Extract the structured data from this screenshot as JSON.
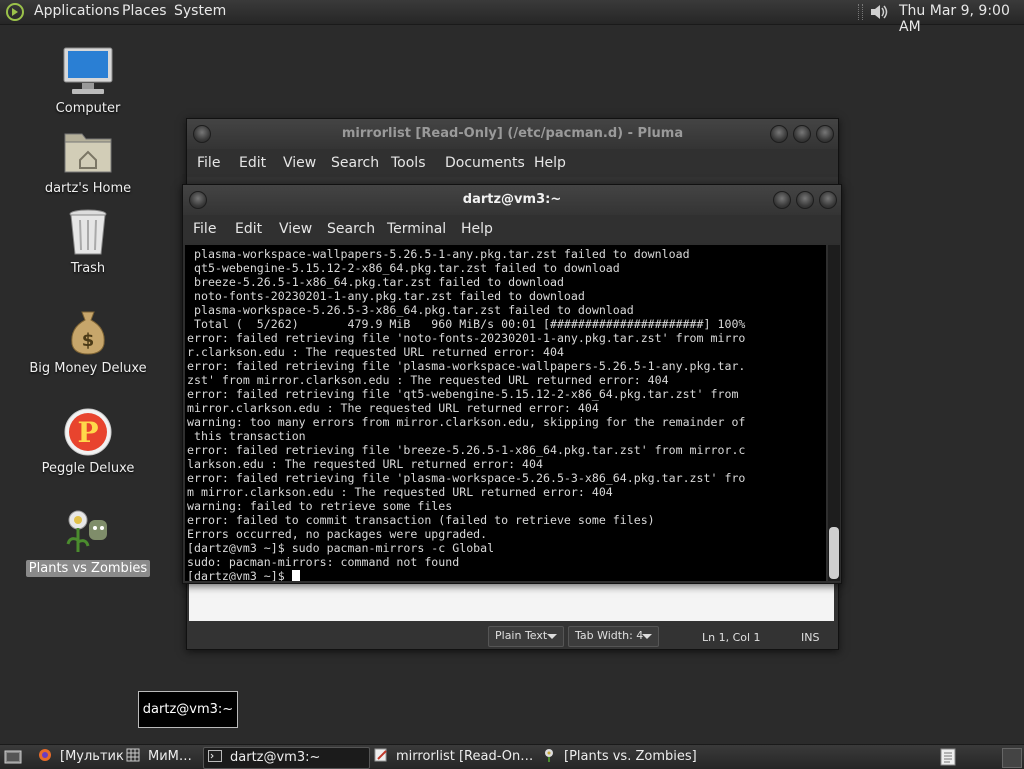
{
  "top_panel": {
    "menus": [
      "Applications",
      "Places",
      "System"
    ],
    "clock": "Thu Mar  9,  9:00 AM"
  },
  "desktop_icons": [
    {
      "label": "Computer",
      "icon": "computer-icon"
    },
    {
      "label": "dartz's Home",
      "icon": "home-folder-icon"
    },
    {
      "label": "Trash",
      "icon": "trash-icon"
    },
    {
      "label": "Big Money Deluxe",
      "icon": "money-bag-icon"
    },
    {
      "label": "Peggle Deluxe",
      "icon": "peggle-icon"
    },
    {
      "label": "Plants vs Zombies",
      "icon": "plants-zombies-icon",
      "selected": true
    }
  ],
  "pluma": {
    "title": "mirrorlist [Read-Only] (/etc/pacman.d) - Pluma",
    "menu": [
      "File",
      "Edit",
      "View",
      "Search",
      "Tools",
      "Documents",
      "Help"
    ],
    "status": {
      "syntax": "Plain Text",
      "tab_width": "Tab Width:  4",
      "position": "Ln 1, Col 1",
      "mode": "INS"
    }
  },
  "terminal": {
    "title": "dartz@vm3:~",
    "menu": [
      "File",
      "Edit",
      "View",
      "Search",
      "Terminal",
      "Help"
    ],
    "lines": [
      " plasma-workspace-wallpapers-5.26.5-1-any.pkg.tar.zst failed to download",
      " qt5-webengine-5.15.12-2-x86_64.pkg.tar.zst failed to download",
      " breeze-5.26.5-1-x86_64.pkg.tar.zst failed to download",
      " noto-fonts-20230201-1-any.pkg.tar.zst failed to download",
      " plasma-workspace-5.26.5-3-x86_64.pkg.tar.zst failed to download",
      " Total (  5/262)       479.9 MiB   960 MiB/s 00:01 [######################] 100%",
      "error: failed retrieving file 'noto-fonts-20230201-1-any.pkg.tar.zst' from mirro",
      "r.clarkson.edu : The requested URL returned error: 404",
      "error: failed retrieving file 'plasma-workspace-wallpapers-5.26.5-1-any.pkg.tar.",
      "zst' from mirror.clarkson.edu : The requested URL returned error: 404",
      "error: failed retrieving file 'qt5-webengine-5.15.12-2-x86_64.pkg.tar.zst' from",
      "mirror.clarkson.edu : The requested URL returned error: 404",
      "warning: too many errors from mirror.clarkson.edu, skipping for the remainder of",
      " this transaction",
      "error: failed retrieving file 'breeze-5.26.5-1-x86_64.pkg.tar.zst' from mirror.c",
      "larkson.edu : The requested URL returned error: 404",
      "error: failed retrieving file 'plasma-workspace-5.26.5-3-x86_64.pkg.tar.zst' fro",
      "m mirror.clarkson.edu : The requested URL returned error: 404",
      "warning: failed to retrieve some files",
      "error: failed to commit transaction (failed to retrieve some files)",
      "Errors occurred, no packages were upgraded.",
      "[dartz@vm3 ~]$ sudo pacman-mirrors -c Global",
      "sudo: pacman-mirrors: command not found"
    ],
    "prompt": "[dartz@vm3 ~]$ "
  },
  "tooltip": "dartz@vm3:~",
  "taskbar": [
    {
      "label": "[Мультик",
      "icon": "browser-icon"
    },
    {
      "label": "МиМ…",
      "icon": "app-grid-icon"
    },
    {
      "label": "dartz@vm3:~",
      "icon": "terminal-icon",
      "active": true
    },
    {
      "label": "mirrorlist [Read-On…",
      "icon": "text-editor-icon"
    },
    {
      "label": "[Plants vs. Zombies]",
      "icon": "plants-zombies-icon"
    }
  ]
}
